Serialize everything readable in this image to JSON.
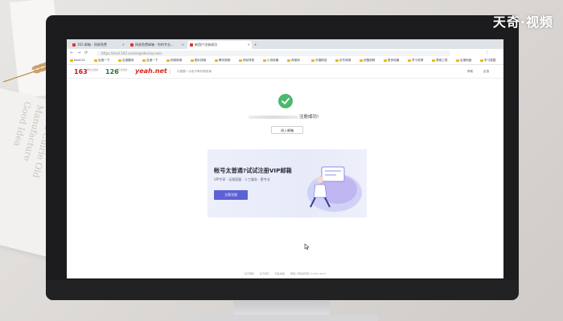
{
  "watermark": "天奇·视频",
  "backdrop": {
    "book_text": "Wind Cuirie Old\nManufacture\nGood Idea"
  },
  "browser": {
    "tabs": [
      {
        "label": "163 邮箱 - 网易免费"
      },
      {
        "label": "网易免费邮箱 - 你的专业..."
      },
      {
        "label": "新用户注册成功"
      }
    ],
    "url": "https://mail.163.com/register/success",
    "bookmarks": [
      "hao123",
      "百度一下",
      "百度翻译",
      "百度一下",
      "网易新闻",
      "图片搜索",
      "腾讯视频",
      "网站导航",
      "小说收藏",
      "淘宝网",
      "天猫精选",
      "京东商城",
      "优酷视频",
      "更多收藏",
      "学习资源",
      "搜索工具",
      "百度网盘",
      "学习强国"
    ]
  },
  "page": {
    "logos": {
      "logo163": "163",
      "logo163_sub": "网易免费邮",
      "logo126": "126",
      "logo126_sub": "网易免费邮",
      "yeah": "yeah.net"
    },
    "slogan": "中国第一大电子邮件服务商",
    "top_right": [
      "帮助",
      "反馈"
    ],
    "success_message": "注册成功!",
    "login_button": "进入邮箱",
    "promo": {
      "title": "帐号太普通?试试注册VIP邮箱",
      "subtitle": "VIP专享 · 无限容量 · 人工服务 · 更专业",
      "button": "立即注册"
    },
    "footer": [
      "关于网易",
      "关于我们",
      "隐私政策",
      "网易公司版权所有 ©1997-2023"
    ]
  },
  "colors": {
    "success_green": "#4bb96d",
    "promo_button": "#5b62d6",
    "brand_163": "#c8161d",
    "brand_126": "#1f7a3a"
  }
}
